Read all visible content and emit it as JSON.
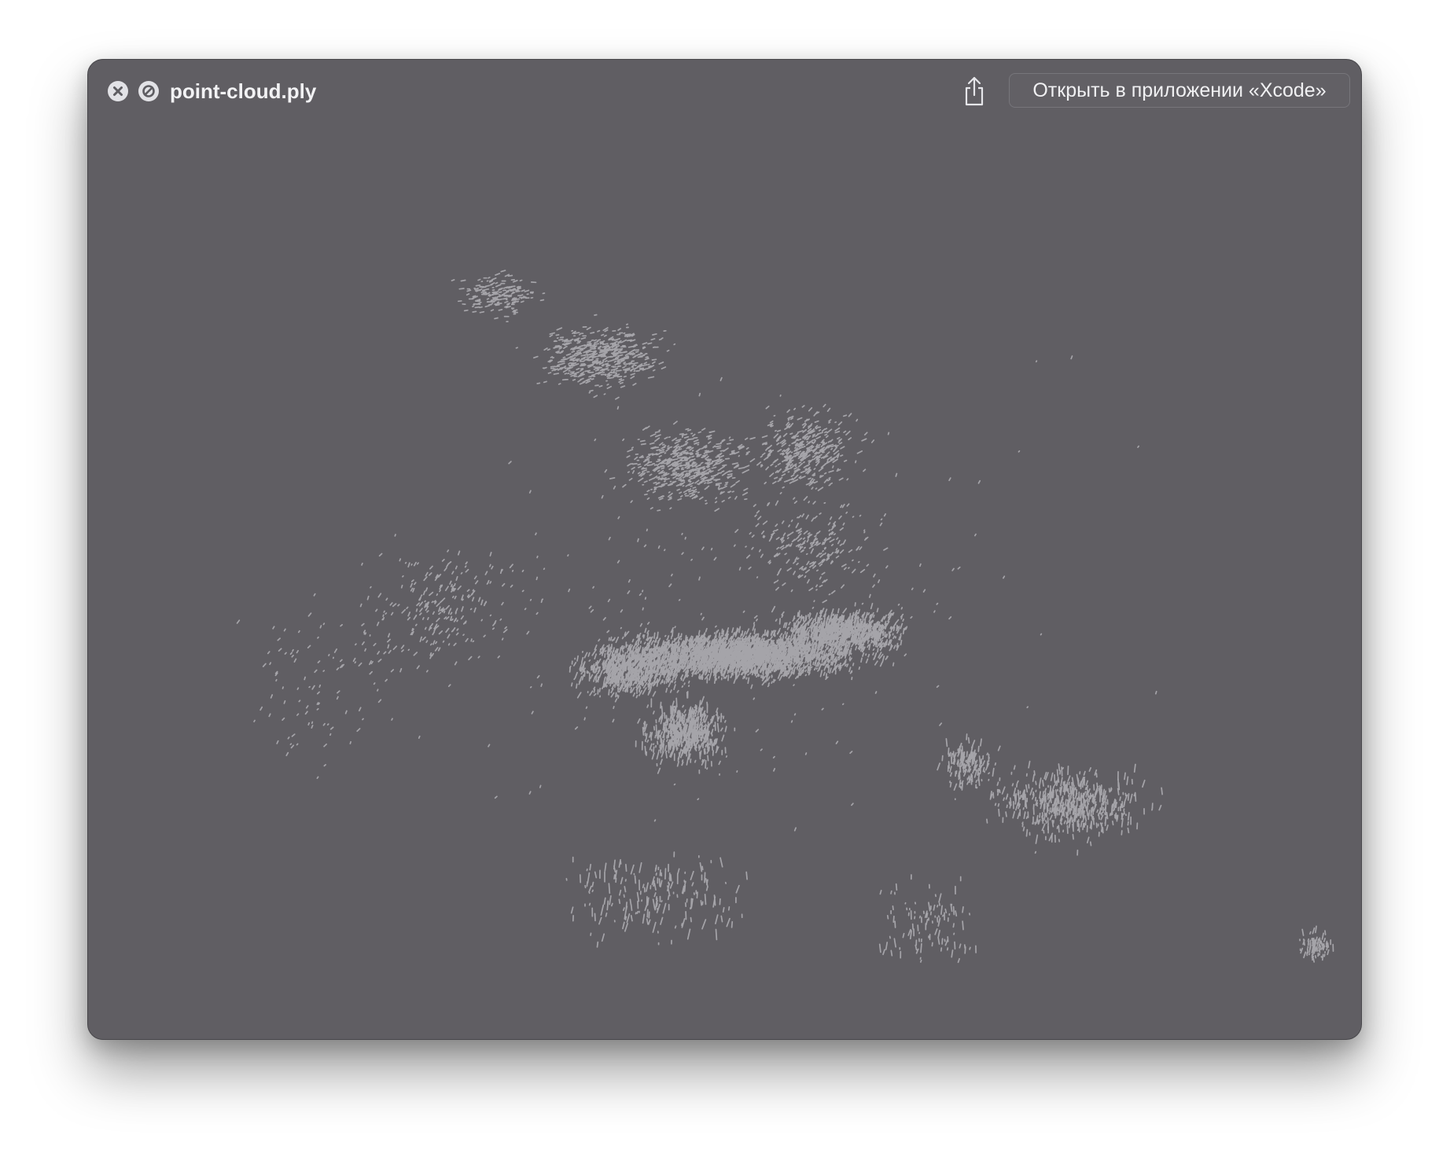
{
  "window": {
    "title": "point-cloud.ply",
    "open_button_label": "Открыть в приложении «Xcode»",
    "controls": {
      "close_icon": "close-icon",
      "stop_icon": "stop-icon",
      "share_icon": "share-icon"
    }
  },
  "colors": {
    "window_background": "#605e63",
    "point_color": "#a9a8ad",
    "control_fill": "#e2e2e6",
    "title_text": "#f2f2f4"
  }
}
